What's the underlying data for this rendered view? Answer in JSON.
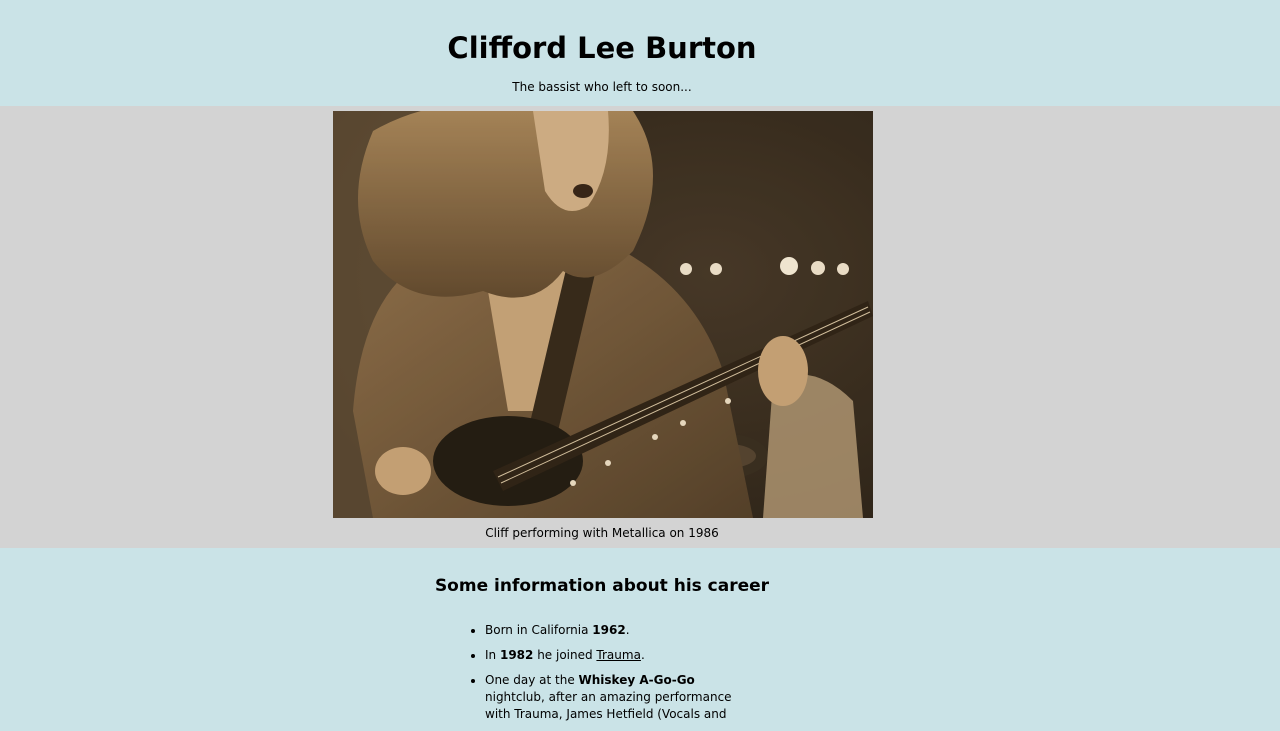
{
  "header": {
    "title": "Clifford Lee Burton",
    "subtitle": "The bassist who left to soon..."
  },
  "photo": {
    "caption": "Cliff performing with Metallica on 1986"
  },
  "career": {
    "heading": "Some information about his career",
    "items": [
      {
        "pre": "Born in California ",
        "bold": "1962",
        "post": "."
      },
      {
        "pre": "In ",
        "bold": "1982",
        "mid": " he joined ",
        "link": "Trauma",
        "post": "."
      },
      {
        "pre": "One day at the ",
        "bold": "Whiskey A-Go-Go",
        "post": " nightclub, after an amazing performance with Trauma, James Hetfield (Vocals and"
      }
    ]
  },
  "colors": {
    "page_background": "#cae3e7",
    "photo_band_background": "#d3d3d3",
    "text": "#000000"
  }
}
